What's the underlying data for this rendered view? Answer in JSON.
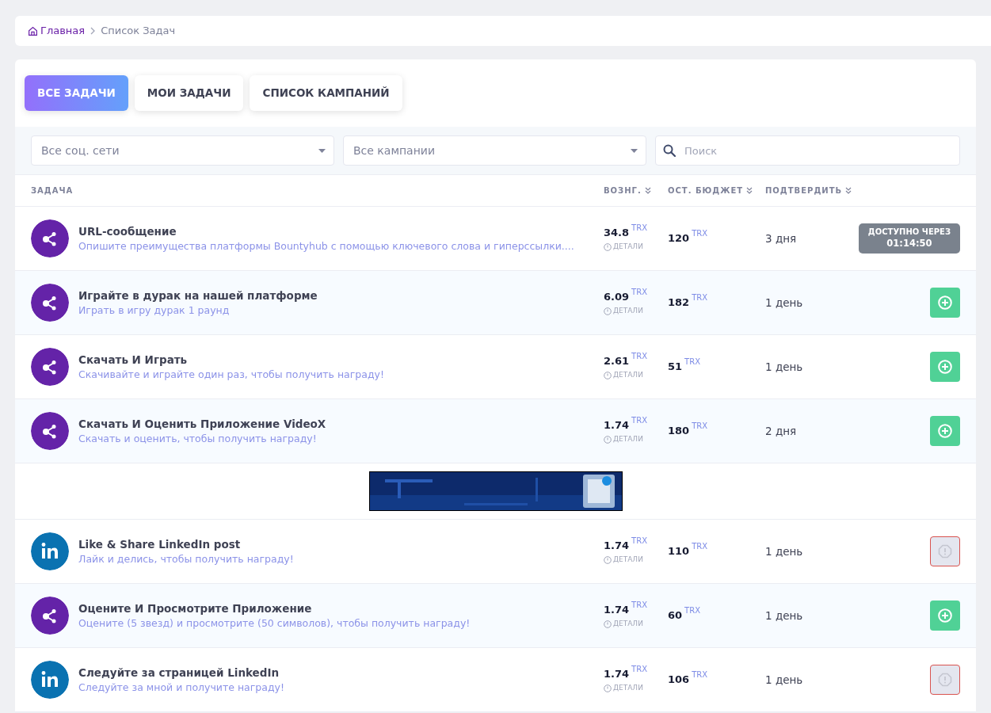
{
  "breadcrumb": {
    "home": "Главная",
    "current": "Список Задач"
  },
  "tabs": [
    {
      "label": "ВСЕ ЗАДАЧИ",
      "selected": true
    },
    {
      "label": "МОИ ЗАДАЧИ",
      "selected": false
    },
    {
      "label": "СПИСОК КАМПАНИЙ",
      "selected": false
    }
  ],
  "filters": {
    "network": "Все соц. сети",
    "campaign": "Все кампании",
    "search_placeholder": "Поиск"
  },
  "table": {
    "columns": [
      "ЗАДАЧА",
      "ВОЗНГ.",
      "ОСТ. БЮДЖЕТ",
      "ПОДТВЕРДИТЬ"
    ],
    "rows": [
      {
        "kind": "share",
        "title": "URL-сообщение",
        "description": "Опишите преимущества платформы Bountyhub с помощью ключевого слова и гиперссылки....",
        "reward": "34.8",
        "reward_unit": "TRX",
        "details": "ДЕТАЛИ",
        "budget": "120",
        "budget_unit": "TRX",
        "confirm": "3 дня",
        "action_label": "ДОСТУПНО ЧЕРЕЗ",
        "action_time": "01:14:50"
      },
      {
        "kind": "share",
        "title": "Играйте в дурак на нашей платформе",
        "description": "Играть в игру дурак 1 раунд",
        "reward": "6.09",
        "reward_unit": "TRX",
        "details": "ДЕТАЛИ",
        "budget": "182",
        "budget_unit": "TRX",
        "confirm": "1 день",
        "available": true
      },
      {
        "kind": "share",
        "title": "Скачать И Играть",
        "description": "Скачивайте и играйте один раз, чтобы получить награду!",
        "reward": "2.61",
        "reward_unit": "TRX",
        "details": "ДЕТАЛИ",
        "budget": "51",
        "budget_unit": "TRX",
        "confirm": "1 день",
        "available": true
      },
      {
        "kind": "share",
        "title": "Скачать И Оценить Приложение VideoX",
        "description": "Скачать и оценить, чтобы получить награду!",
        "reward": "1.74",
        "reward_unit": "TRX",
        "details": "ДЕТАЛИ",
        "budget": "180",
        "budget_unit": "TRX",
        "confirm": "2 дня",
        "available": true
      },
      {
        "kind": "ad"
      },
      {
        "kind": "linkedin",
        "title": "Like & Share LinkedIn post",
        "description": "Лайк и делись, чтобы получить награду!",
        "reward": "1.74",
        "reward_unit": "TRX",
        "details": "ДЕТАЛИ",
        "budget": "110",
        "budget_unit": "TRX",
        "confirm": "1 день",
        "available": false
      },
      {
        "kind": "share",
        "title": "Оцените И Просмотрите Приложение",
        "description": "Оцените (5 звезд) и просмотрите (50 символов), чтобы получить награду!",
        "reward": "1.74",
        "reward_unit": "TRX",
        "details": "ДЕТАЛИ",
        "budget": "60",
        "budget_unit": "TRX",
        "confirm": "1 день",
        "available": true
      },
      {
        "kind": "linkedin",
        "title": "Следуйте за страницей LinkedIn",
        "description": "Следуйте за мной и получите награду!",
        "reward": "1.74",
        "reward_unit": "TRX",
        "details": "ДЕТАЛИ",
        "budget": "106",
        "budget_unit": "TRX",
        "confirm": "1 день",
        "available": false
      }
    ]
  }
}
